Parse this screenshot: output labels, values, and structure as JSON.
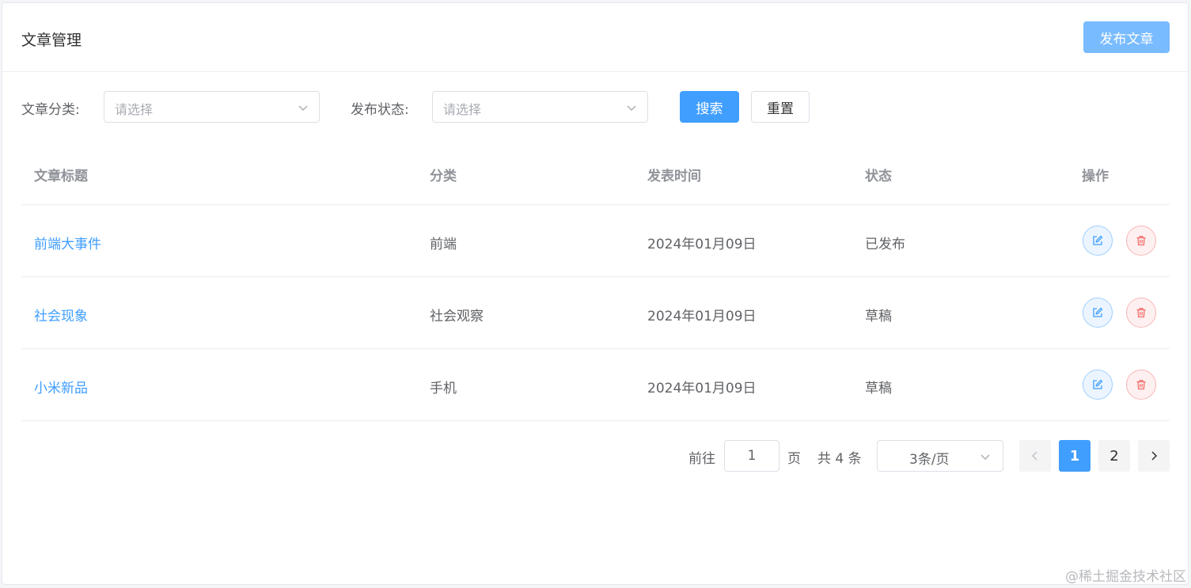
{
  "header": {
    "title": "文章管理",
    "publish_label": "发布文章"
  },
  "filters": {
    "category_label": "文章分类:",
    "category_placeholder": "请选择",
    "status_label": "发布状态:",
    "status_placeholder": "请选择",
    "search_label": "搜索",
    "reset_label": "重置"
  },
  "table": {
    "columns": [
      "文章标题",
      "分类",
      "发表时间",
      "状态",
      "操作"
    ],
    "rows": [
      {
        "title": "前端大事件",
        "category": "前端",
        "date": "2024年01月09日",
        "status": "已发布"
      },
      {
        "title": "社会现象",
        "category": "社会观察",
        "date": "2024年01月09日",
        "status": "草稿"
      },
      {
        "title": "小米新品",
        "category": "手机",
        "date": "2024年01月09日",
        "status": "草稿"
      }
    ]
  },
  "pagination": {
    "goto_label": "前往",
    "goto_value": "1",
    "page_suffix": "页",
    "total_text": "共 4 条",
    "page_size": "3条/页",
    "pages": [
      "1",
      "2"
    ],
    "current_page": "1"
  },
  "watermark": "@稀土掘金技术社区",
  "colors": {
    "primary": "#409eff",
    "primary_light": "#79bbff",
    "danger": "#f56c6c"
  }
}
